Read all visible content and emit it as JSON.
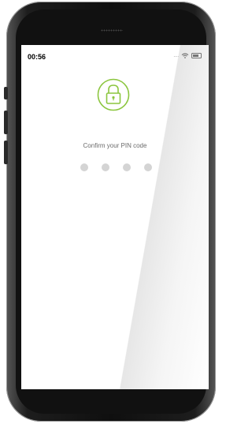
{
  "status_bar": {
    "time": "00:56",
    "signal": "....",
    "wifi_icon": "wifi-icon",
    "battery_icon": "battery-icon"
  },
  "pin_screen": {
    "lock_icon": "lock-icon",
    "accent_color": "#8cc63f",
    "prompt": "Confirm your PIN code",
    "pin_length": 4,
    "dot_color": "#d4d4d4"
  }
}
